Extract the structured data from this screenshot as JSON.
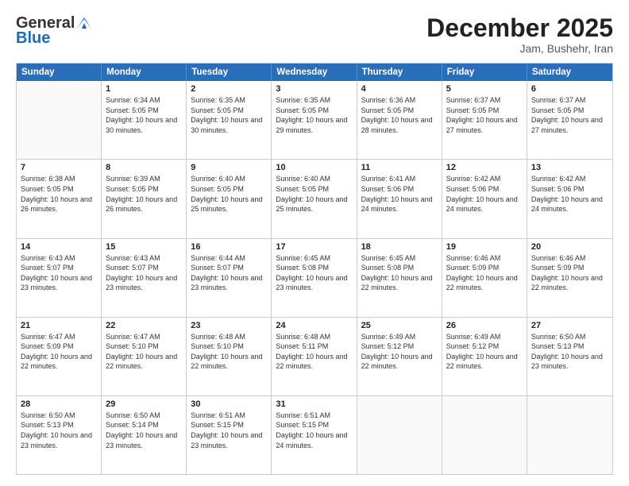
{
  "header": {
    "logo_general": "General",
    "logo_blue": "Blue",
    "month": "December 2025",
    "location": "Jam, Bushehr, Iran"
  },
  "calendar": {
    "days_of_week": [
      "Sunday",
      "Monday",
      "Tuesday",
      "Wednesday",
      "Thursday",
      "Friday",
      "Saturday"
    ],
    "rows": [
      [
        {
          "day": "",
          "sunrise": "",
          "sunset": "",
          "daylight": "",
          "empty": true
        },
        {
          "day": "1",
          "sunrise": "Sunrise: 6:34 AM",
          "sunset": "Sunset: 5:05 PM",
          "daylight": "Daylight: 10 hours and 30 minutes."
        },
        {
          "day": "2",
          "sunrise": "Sunrise: 6:35 AM",
          "sunset": "Sunset: 5:05 PM",
          "daylight": "Daylight: 10 hours and 30 minutes."
        },
        {
          "day": "3",
          "sunrise": "Sunrise: 6:35 AM",
          "sunset": "Sunset: 5:05 PM",
          "daylight": "Daylight: 10 hours and 29 minutes."
        },
        {
          "day": "4",
          "sunrise": "Sunrise: 6:36 AM",
          "sunset": "Sunset: 5:05 PM",
          "daylight": "Daylight: 10 hours and 28 minutes."
        },
        {
          "day": "5",
          "sunrise": "Sunrise: 6:37 AM",
          "sunset": "Sunset: 5:05 PM",
          "daylight": "Daylight: 10 hours and 27 minutes."
        },
        {
          "day": "6",
          "sunrise": "Sunrise: 6:37 AM",
          "sunset": "Sunset: 5:05 PM",
          "daylight": "Daylight: 10 hours and 27 minutes."
        }
      ],
      [
        {
          "day": "7",
          "sunrise": "Sunrise: 6:38 AM",
          "sunset": "Sunset: 5:05 PM",
          "daylight": "Daylight: 10 hours and 26 minutes."
        },
        {
          "day": "8",
          "sunrise": "Sunrise: 6:39 AM",
          "sunset": "Sunset: 5:05 PM",
          "daylight": "Daylight: 10 hours and 26 minutes."
        },
        {
          "day": "9",
          "sunrise": "Sunrise: 6:40 AM",
          "sunset": "Sunset: 5:05 PM",
          "daylight": "Daylight: 10 hours and 25 minutes."
        },
        {
          "day": "10",
          "sunrise": "Sunrise: 6:40 AM",
          "sunset": "Sunset: 5:05 PM",
          "daylight": "Daylight: 10 hours and 25 minutes."
        },
        {
          "day": "11",
          "sunrise": "Sunrise: 6:41 AM",
          "sunset": "Sunset: 5:06 PM",
          "daylight": "Daylight: 10 hours and 24 minutes."
        },
        {
          "day": "12",
          "sunrise": "Sunrise: 6:42 AM",
          "sunset": "Sunset: 5:06 PM",
          "daylight": "Daylight: 10 hours and 24 minutes."
        },
        {
          "day": "13",
          "sunrise": "Sunrise: 6:42 AM",
          "sunset": "Sunset: 5:06 PM",
          "daylight": "Daylight: 10 hours and 24 minutes."
        }
      ],
      [
        {
          "day": "14",
          "sunrise": "Sunrise: 6:43 AM",
          "sunset": "Sunset: 5:07 PM",
          "daylight": "Daylight: 10 hours and 23 minutes."
        },
        {
          "day": "15",
          "sunrise": "Sunrise: 6:43 AM",
          "sunset": "Sunset: 5:07 PM",
          "daylight": "Daylight: 10 hours and 23 minutes."
        },
        {
          "day": "16",
          "sunrise": "Sunrise: 6:44 AM",
          "sunset": "Sunset: 5:07 PM",
          "daylight": "Daylight: 10 hours and 23 minutes."
        },
        {
          "day": "17",
          "sunrise": "Sunrise: 6:45 AM",
          "sunset": "Sunset: 5:08 PM",
          "daylight": "Daylight: 10 hours and 23 minutes."
        },
        {
          "day": "18",
          "sunrise": "Sunrise: 6:45 AM",
          "sunset": "Sunset: 5:08 PM",
          "daylight": "Daylight: 10 hours and 22 minutes."
        },
        {
          "day": "19",
          "sunrise": "Sunrise: 6:46 AM",
          "sunset": "Sunset: 5:09 PM",
          "daylight": "Daylight: 10 hours and 22 minutes."
        },
        {
          "day": "20",
          "sunrise": "Sunrise: 6:46 AM",
          "sunset": "Sunset: 5:09 PM",
          "daylight": "Daylight: 10 hours and 22 minutes."
        }
      ],
      [
        {
          "day": "21",
          "sunrise": "Sunrise: 6:47 AM",
          "sunset": "Sunset: 5:09 PM",
          "daylight": "Daylight: 10 hours and 22 minutes."
        },
        {
          "day": "22",
          "sunrise": "Sunrise: 6:47 AM",
          "sunset": "Sunset: 5:10 PM",
          "daylight": "Daylight: 10 hours and 22 minutes."
        },
        {
          "day": "23",
          "sunrise": "Sunrise: 6:48 AM",
          "sunset": "Sunset: 5:10 PM",
          "daylight": "Daylight: 10 hours and 22 minutes."
        },
        {
          "day": "24",
          "sunrise": "Sunrise: 6:48 AM",
          "sunset": "Sunset: 5:11 PM",
          "daylight": "Daylight: 10 hours and 22 minutes."
        },
        {
          "day": "25",
          "sunrise": "Sunrise: 6:49 AM",
          "sunset": "Sunset: 5:12 PM",
          "daylight": "Daylight: 10 hours and 22 minutes."
        },
        {
          "day": "26",
          "sunrise": "Sunrise: 6:49 AM",
          "sunset": "Sunset: 5:12 PM",
          "daylight": "Daylight: 10 hours and 22 minutes."
        },
        {
          "day": "27",
          "sunrise": "Sunrise: 6:50 AM",
          "sunset": "Sunset: 5:13 PM",
          "daylight": "Daylight: 10 hours and 23 minutes."
        }
      ],
      [
        {
          "day": "28",
          "sunrise": "Sunrise: 6:50 AM",
          "sunset": "Sunset: 5:13 PM",
          "daylight": "Daylight: 10 hours and 23 minutes."
        },
        {
          "day": "29",
          "sunrise": "Sunrise: 6:50 AM",
          "sunset": "Sunset: 5:14 PM",
          "daylight": "Daylight: 10 hours and 23 minutes."
        },
        {
          "day": "30",
          "sunrise": "Sunrise: 6:51 AM",
          "sunset": "Sunset: 5:15 PM",
          "daylight": "Daylight: 10 hours and 23 minutes."
        },
        {
          "day": "31",
          "sunrise": "Sunrise: 6:51 AM",
          "sunset": "Sunset: 5:15 PM",
          "daylight": "Daylight: 10 hours and 24 minutes."
        },
        {
          "day": "",
          "sunrise": "",
          "sunset": "",
          "daylight": "",
          "empty": true
        },
        {
          "day": "",
          "sunrise": "",
          "sunset": "",
          "daylight": "",
          "empty": true
        },
        {
          "day": "",
          "sunrise": "",
          "sunset": "",
          "daylight": "",
          "empty": true
        }
      ]
    ]
  }
}
